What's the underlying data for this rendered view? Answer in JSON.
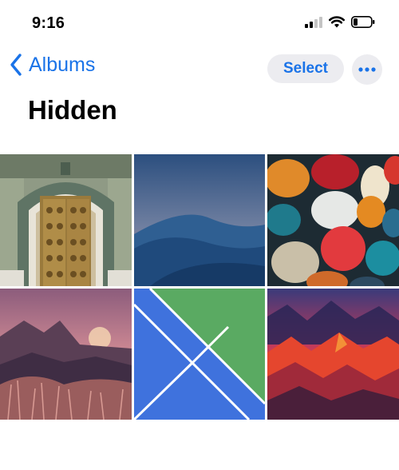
{
  "status": {
    "time": "9:16"
  },
  "nav": {
    "back_label": "Albums",
    "select_label": "Select"
  },
  "title": "Hidden",
  "colors": {
    "accent": "#1a73e8",
    "button_bg": "#ececf0"
  },
  "icons": [
    "chevron-left-icon",
    "ellipsis-icon",
    "signal-icon",
    "wifi-icon",
    "battery-icon"
  ],
  "photos": [
    {
      "name": "palace-door-photo"
    },
    {
      "name": "blue-dunes-wallpaper"
    },
    {
      "name": "colorful-pebbles-wallpaper"
    },
    {
      "name": "pink-mountains-photo"
    },
    {
      "name": "geometric-blue-green-wallpaper"
    },
    {
      "name": "red-mountains-wallpaper"
    }
  ]
}
